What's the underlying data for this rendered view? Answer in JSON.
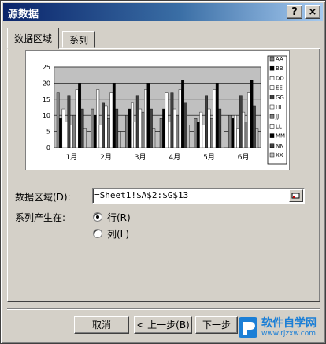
{
  "window": {
    "title": "源数据"
  },
  "title_buttons": {
    "help": "?",
    "close": "×"
  },
  "tabs": [
    {
      "label": "数据区域"
    },
    {
      "label": "系列"
    }
  ],
  "data_range": {
    "label": "数据区域(D):",
    "value": "=Sheet1!$A$2:$G$13"
  },
  "series_in": {
    "label": "系列产生在:",
    "options": [
      {
        "label": "行(R)",
        "selected": true
      },
      {
        "label": "列(L)",
        "selected": false
      }
    ]
  },
  "buttons": {
    "cancel": "取消",
    "back": "< 上一步(B)",
    "next": "下一步"
  },
  "watermark": {
    "text": "软件自学网",
    "sub": "www.rjzxw.com"
  },
  "chart_data": {
    "type": "bar",
    "categories": [
      "1月",
      "2月",
      "3月",
      "4月",
      "5月",
      "6月"
    ],
    "ylim": [
      0,
      25
    ],
    "yticks": [
      0,
      5,
      10,
      15,
      20,
      25
    ],
    "series": [
      {
        "name": "AA",
        "values": [
          17,
          12,
          10,
          9,
          9,
          10
        ]
      },
      {
        "name": "BB",
        "values": [
          9,
          10,
          12,
          12,
          8,
          9
        ]
      },
      {
        "name": "DD",
        "values": [
          12,
          18,
          14,
          17,
          11,
          10
        ]
      },
      {
        "name": "EE",
        "values": [
          8,
          7,
          8,
          8,
          7,
          6
        ]
      },
      {
        "name": "GG",
        "values": [
          16,
          14,
          16,
          17,
          16,
          16
        ]
      },
      {
        "name": "HH",
        "values": [
          7,
          13,
          12,
          12,
          12,
          11
        ]
      },
      {
        "name": "JJ",
        "values": [
          10,
          9,
          11,
          10,
          9,
          8
        ]
      },
      {
        "name": "LL",
        "values": [
          18,
          17,
          18,
          18,
          18,
          17
        ]
      },
      {
        "name": "MM",
        "values": [
          20,
          20,
          20,
          21,
          20,
          21
        ]
      },
      {
        "name": "NN",
        "values": [
          12,
          12,
          12,
          14,
          12,
          13
        ]
      },
      {
        "name": "XX",
        "values": [
          6,
          5,
          6,
          7,
          7,
          6
        ]
      }
    ],
    "colors": [
      "#808080",
      "#000000",
      "#ffffff",
      "#ffffff",
      "#404040",
      "#ffffff",
      "#808080",
      "#ffffff",
      "#000000",
      "#404040",
      "#c0c0c0"
    ],
    "grid": true,
    "legend_position": "right"
  }
}
